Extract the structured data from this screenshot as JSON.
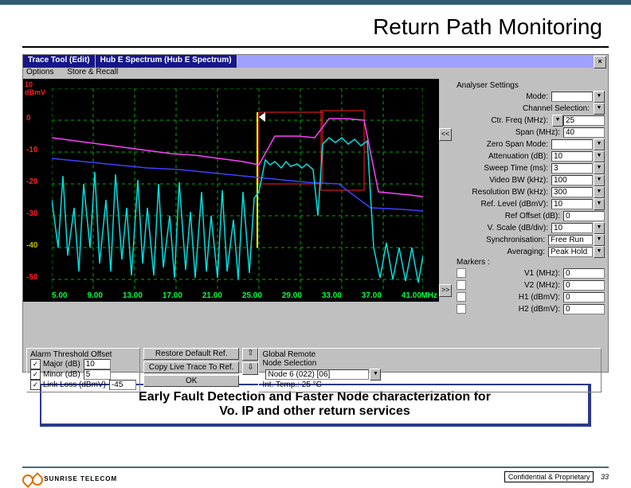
{
  "title": "Return Path Monitoring",
  "titlebar": {
    "tab1": "Trace Tool (Edit)",
    "tab2": "Hub E Spectrum (Hub E Spectrum)"
  },
  "menubar": {
    "m1": "Options",
    "m2": "Store & Recall"
  },
  "chart_data": {
    "type": "line",
    "xlabel": "MHz",
    "ylabel": "dBmV",
    "x_ticks": [
      "5.00",
      "9.00",
      "13.00",
      "17.00",
      "21.00",
      "25.00",
      "29.00",
      "33.00",
      "37.00",
      "41.00"
    ],
    "y_ticks": [
      "10",
      "0",
      "-10",
      "-20",
      "-30",
      "-40",
      "-50"
    ],
    "ylim": [
      -50,
      10
    ],
    "xlim": [
      5,
      41
    ],
    "series": [
      {
        "name": "trace-cyan",
        "color": "#00e0e0"
      },
      {
        "name": "trace-magenta",
        "color": "#ff40ff"
      },
      {
        "name": "trace-blue",
        "color": "#4040ff"
      }
    ]
  },
  "settings": {
    "header1": "Analyser Settings",
    "mode_label": "Mode:",
    "chan_label": "Channel Selection:",
    "ctr_label": "Ctr. Freq (MHz):",
    "ctr_val": "25",
    "span_label": "Span (MHz):",
    "span_val": "40",
    "zspan_label": "Zero Span Mode:",
    "atten_label": "Attenuation (dB):",
    "atten_val": "10",
    "sweep_label": "Sweep Time (ms):",
    "sweep_val": "3",
    "vbw_label": "Video BW (kHz):",
    "vbw_val": "100",
    "rbw_label": "Resolution BW (kHz):",
    "rbw_val": "300",
    "ref_label": "Ref. Level (dBmV):",
    "ref_val": "10",
    "refo_label": "Ref Offset (dB):",
    "refo_val": "0",
    "vscale_label": "V. Scale (dB/div):",
    "vscale_val": "10",
    "sync_label": "Synchronisation:",
    "sync_val": "Free Run",
    "avg_label": "Averaging:",
    "avg_val": "Peak Hold",
    "markers_label": "Markers :",
    "m_v1": "V1 (MHz):",
    "m_v1_val": "0",
    "m_v2": "V2 (MHz):",
    "m_v2_val": "0",
    "m_h1": "H1 (dBmV):",
    "m_h1_val": "0",
    "m_h2": "H2 (dBmV):",
    "m_h2_val": "0"
  },
  "bottom": {
    "alarm_title": "Alarm Threshold Offset",
    "major": "Major (dB)",
    "major_val": "10",
    "minor": "Minor (dB)",
    "minor_val": "5",
    "link": "Link Loss (dBmV)",
    "link_val": "-45",
    "btn1": "Restore Default Ref.",
    "btn2": "Copy Live Trace To Ref.",
    "btn3": "OK",
    "remote_title": "Global Remote",
    "node_title": "Node Selection",
    "node_val": "Node 6 (022) [06]",
    "temp": "Int. Temp.: 25 °C"
  },
  "callout": {
    "line1": "Early Fault Detection and Faster Node characterization for",
    "line2": "Vo. IP and other return services"
  },
  "footer": {
    "conf": "Confidential & Proprietary",
    "page": "33",
    "brand": "SUNRISE TELECOM"
  }
}
